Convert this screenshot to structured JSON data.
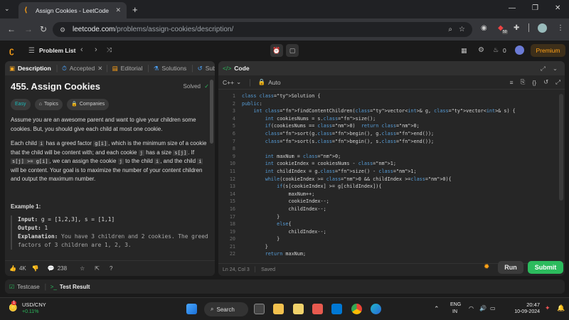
{
  "browser": {
    "tab_title": "Assign Cookies - LeetCode",
    "url_domain": "leetcode.com",
    "url_path": "/problems/assign-cookies/description/",
    "ext_badge": "50"
  },
  "nav": {
    "problem_list": "Problem List",
    "premium": "Premium",
    "streak": "0"
  },
  "left_tabs": {
    "description": "Description",
    "accepted": "Accepted",
    "editorial": "Editorial",
    "solutions": "Solutions",
    "submissions": "Submi"
  },
  "problem": {
    "title": "455. Assign Cookies",
    "status": "Solved",
    "difficulty": "Easy",
    "topics": "Topics",
    "companies": "Companies",
    "p1": "Assume you are an awesome parent and want to give your children some cookies. But, you should give each child at most one cookie.",
    "p2a": "Each child ",
    "p2b": "i",
    "p2c": " has a greed factor ",
    "p2d": "g[i]",
    "p2e": ", which is the minimum size of a cookie that the child will be content with; and each cookie ",
    "p2f": "j",
    "p2g": " has a size ",
    "p2h": "s[j]",
    "p2i": ". If ",
    "p2j": "s[j] >= g[i]",
    "p2k": ", we can assign the cookie ",
    "p2l": "j",
    "p2m": " to the child ",
    "p2n": "i",
    "p2o": ", and the child ",
    "p2p": "i",
    "p2q": " will be content. Your goal is to maximize the number of your content children and output the maximum number.",
    "example_title": "Example 1:",
    "input_label": "Input:",
    "input_val": " g = [1,2,3], s = [1,1]",
    "output_label": "Output:",
    "output_val": " 1",
    "expl_label": "Explanation:",
    "expl_val": " You have 3 children and 2 cookies. The greed factors of 3 children are 1, 2, 3."
  },
  "footer_left": {
    "likes": "4K",
    "comments": "238"
  },
  "code_panel": {
    "title": "Code",
    "language": "C++",
    "mode": "Auto",
    "status_pos": "Ln 24, Col 3",
    "status_saved": "Saved"
  },
  "code_lines": [
    "class Solution {",
    "public:",
    "    int findContentChildren(vector<int>& g, vector<int>& s) {",
    "        int cookiesNums = s.size();",
    "        if(cookiesNums == 0)  return 0;",
    "        sort(g.begin(), g.end());",
    "        sort(s.begin(), s.end());",
    "",
    "        int maxNum = 0;",
    "        int cookieIndex = cookiesNums - 1;",
    "        int childIndex = g.size() - 1;",
    "        while(cookieIndex >= 0 && childIndex >=0){",
    "            if(s[cookieIndex] >= g[childIndex]){",
    "                maxNum++;",
    "                cookieIndex--;",
    "                childIndex--;",
    "            }",
    "            else{",
    "                childIndex--;",
    "            }",
    "        }",
    "        return maxNum;"
  ],
  "line_numbers": [
    "1",
    "2",
    "3",
    "4",
    "5",
    "6",
    "7",
    "8",
    "9",
    "10",
    "11",
    "12",
    "13",
    "14",
    "15",
    "16",
    "17",
    "18",
    "19",
    "20",
    "21",
    "22"
  ],
  "actions": {
    "run": "Run",
    "submit": "Submit"
  },
  "bottom": {
    "testcase": "Testcase",
    "test_result": "Test Result"
  },
  "taskbar": {
    "stock_name": "USD/CNY",
    "stock_change": "+0.11%",
    "search": "Search",
    "lang1": "ENG",
    "lang2": "IN",
    "time": "20:47",
    "date": "10-09-2024",
    "notif": "1"
  },
  "colors": {
    "accent_green": "#2cbb5d",
    "easy": "#1cbaba",
    "premium": "#ffa116"
  }
}
